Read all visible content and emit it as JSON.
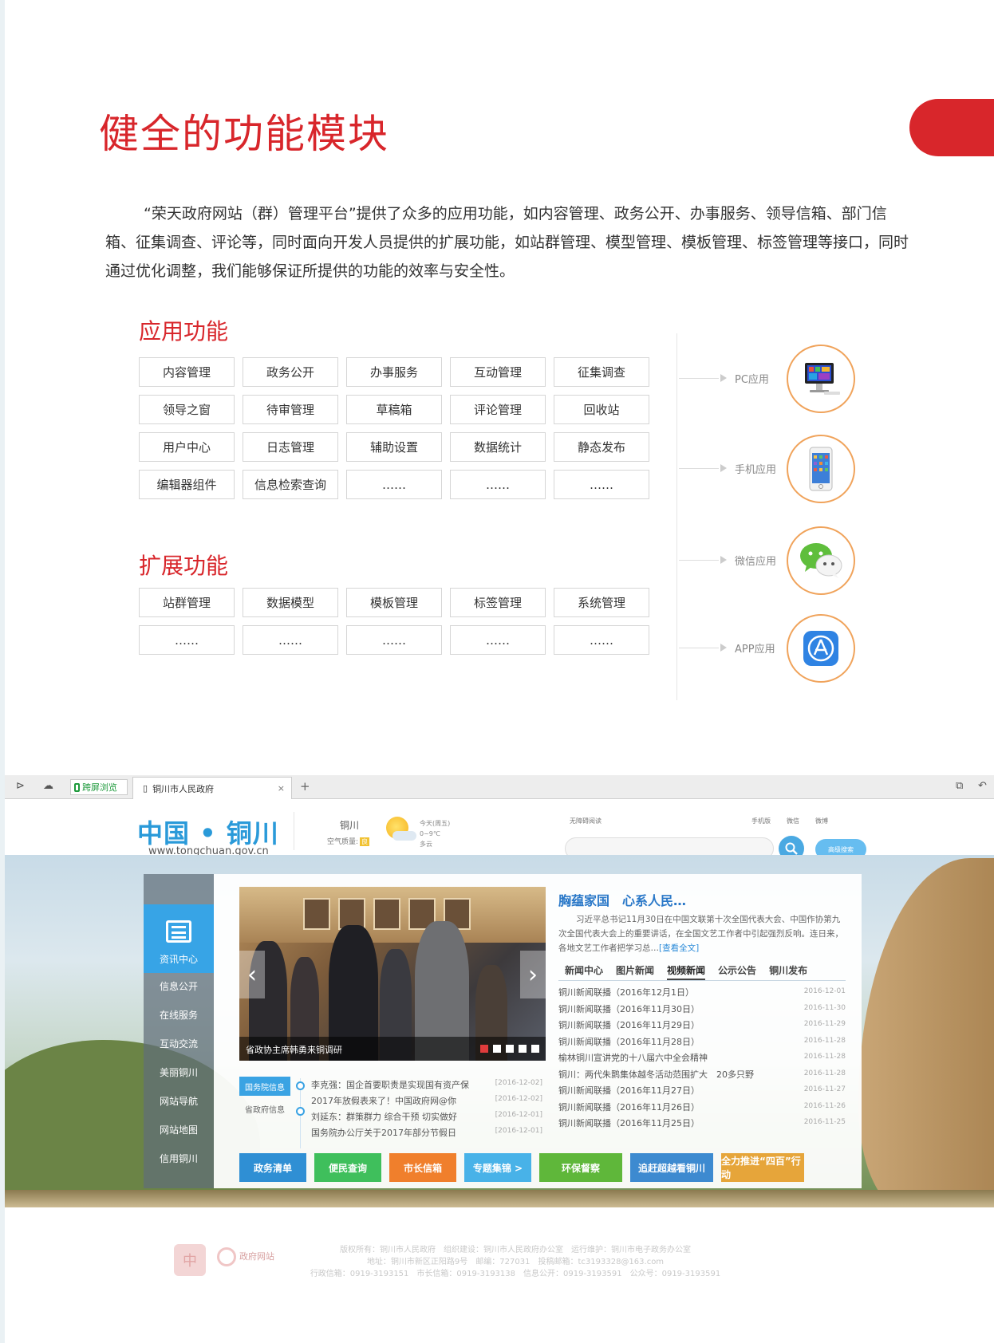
{
  "title": "健全的功能模块",
  "intro": "“荣天政府网站（群）管理平台”提供了众多的应用功能，如内容管理、政务公开、办事服务、领导信箱、部门信箱、征集调查、评论等，同时面向开发人员提供的扩展功能，如站群管理、模型管理、模板管理、标签管理等接口，同时通过优化调整，我们能够保证所提供的功能的效率与安全性。",
  "app_section": {
    "title": "应用功能",
    "cells": [
      "内容管理",
      "政务公开",
      "办事服务",
      "互动管理",
      "征集调查",
      "领导之窗",
      "待审管理",
      "草稿箱",
      "评论管理",
      "回收站",
      "用户中心",
      "日志管理",
      "辅助设置",
      "数据统计",
      "静态发布",
      "编辑器组件",
      "信息检索查询",
      "……",
      "……",
      "……"
    ]
  },
  "ext_section": {
    "title": "扩展功能",
    "cells": [
      "站群管理",
      "数据模型",
      "模板管理",
      "标签管理",
      "系统管理",
      "……",
      "……",
      "……",
      "……",
      "……"
    ]
  },
  "apps": [
    {
      "label": "PC应用",
      "icon": "desktop-computer-icon"
    },
    {
      "label": "手机应用",
      "icon": "smartphone-icon"
    },
    {
      "label": "微信应用",
      "icon": "wechat-icon"
    },
    {
      "label": "APP应用",
      "icon": "app-store-icon"
    }
  ],
  "browser": {
    "tab_green": "跨屏浏览",
    "tab_title": "铜川市人民政府",
    "tab_close": "×",
    "tab_plus": "+"
  },
  "site": {
    "logo": "中国 • 铜川",
    "url": "www.tongchuan.gov.cn",
    "city": "铜川",
    "air_label": "空气质量:",
    "air_badge": "良",
    "weather": [
      "今天(周五)",
      "0~9℃",
      "多云"
    ],
    "accessibility": "无障碍阅读",
    "top_links": [
      "手机版",
      "微信",
      "微博"
    ],
    "advanced_search": "高级搜索"
  },
  "sidenav": {
    "active": "资讯中心",
    "items": [
      "信息公开",
      "在线服务",
      "互动交流",
      "美丽铜川",
      "网站导航",
      "网站地图",
      "信用铜川"
    ]
  },
  "slide": {
    "caption": "省政协主席韩勇来铜调研"
  },
  "gov_tabs": [
    "国务院信息",
    "省政府信息"
  ],
  "gov_news": [
    {
      "title": "李克强：国企首要职责是实现国有资产保",
      "date": "[2016-12-02]"
    },
    {
      "title": "2017年放假表来了！中国政府网@你",
      "date": "[2016-12-02]"
    },
    {
      "title": "刘延东：群策群力 综合干预 切实做好",
      "date": "[2016-12-01]"
    },
    {
      "title": "国务院办公厅关于2017年部分节假日",
      "date": "[2016-12-01]"
    }
  ],
  "headline": {
    "title": "胸蕴家国　心系人民…",
    "summary": "习近平总书记11月30日在中国文联第十次全国代表大会、中国作协第九次全国代表大会上的重要讲话，在全国文艺工作者中引起强烈反响。连日来，各地文艺工作者把学习总…",
    "more": "[查看全文]"
  },
  "news_tabs": [
    "新闻中心",
    "图片新闻",
    "视频新闻",
    "公示公告",
    "铜川发布"
  ],
  "news_active_tab": "视频新闻",
  "news": [
    {
      "title": "铜川新闻联播（2016年12月1日）",
      "date": "2016-12-01"
    },
    {
      "title": "铜川新闻联播（2016年11月30日）",
      "date": "2016-11-30"
    },
    {
      "title": "铜川新闻联播（2016年11月29日）",
      "date": "2016-11-29"
    },
    {
      "title": "铜川新闻联播（2016年11月28日）",
      "date": "2016-11-28"
    },
    {
      "title": "榆林铜川宣讲党的十八届六中全会精神",
      "date": "2016-11-28"
    },
    {
      "title": "铜川：两代朱鹮集体越冬活动范围扩大　20多只野",
      "date": "2016-11-28"
    },
    {
      "title": "铜川新闻联播（2016年11月27日）",
      "date": "2016-11-27"
    },
    {
      "title": "铜川新闻联播（2016年11月26日）",
      "date": "2016-11-26"
    },
    {
      "title": "铜川新闻联播（2016年11月25日）",
      "date": "2016-11-25"
    }
  ],
  "quick_buttons": [
    {
      "label": "政务清单",
      "color": "#2f8fd4"
    },
    {
      "label": "便民查询",
      "color": "#3fbf5c"
    },
    {
      "label": "市长信箱",
      "color": "#f07f2c"
    },
    {
      "label": "专题集锦 >",
      "color": "#48b2e8"
    },
    {
      "label": "环保督察",
      "color": "#5fb73a"
    },
    {
      "label": "追赶超越看铜川",
      "color": "#3d8ad0"
    },
    {
      "label": "全力推进“四百”行动",
      "color": "#e6a53a"
    }
  ],
  "footer": {
    "logo2": "政府网站",
    "line1": "版权所有：铜川市人民政府　组织建设：铜川市人民政府办公室　运行维护：铜川市电子政务办公室",
    "line2": "地址：铜川市新区正阳路9号　邮编：727031　投稿邮箱：tc3193328@163.com",
    "line3": "行政信箱：0919-3193151　市长信箱：0919-3193138　信息公开：0919-3193591　公众号：0919-3193591"
  }
}
